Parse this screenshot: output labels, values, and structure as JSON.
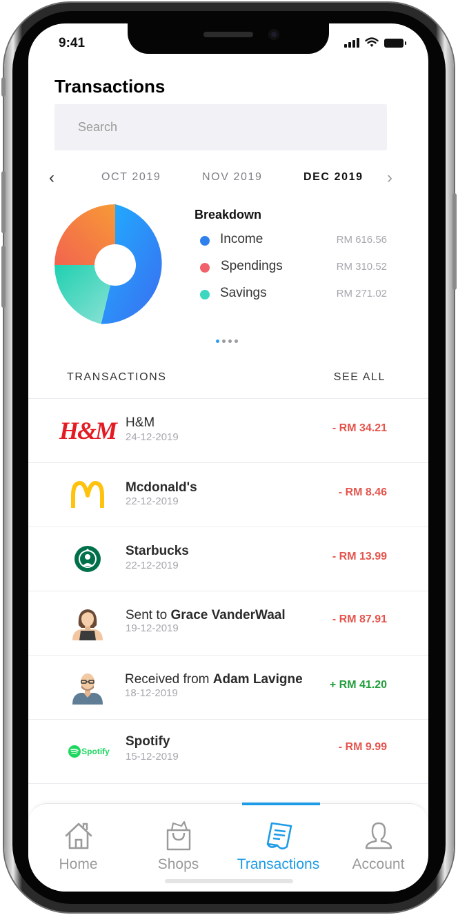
{
  "status": {
    "time": "9:41"
  },
  "header": {
    "title": "Transactions"
  },
  "search": {
    "placeholder": "Search"
  },
  "months": {
    "items": [
      "OCT 2019",
      "NOV 2019",
      "DEC 2019"
    ],
    "active": "DEC 2019",
    "prev_icon": "chevron-left-icon",
    "next_icon": "chevron-right-icon"
  },
  "breakdown": {
    "title": "Breakdown",
    "items": [
      {
        "label": "Income",
        "amount": "RM 616.56",
        "color": "#2f80ed"
      },
      {
        "label": "Spendings",
        "amount": "RM 310.52",
        "color": "#f0616b"
      },
      {
        "label": "Savings",
        "amount": "RM 271.02",
        "color": "#3dd6c0"
      }
    ]
  },
  "pager": {
    "count": 4,
    "active": 0
  },
  "transactions_section": {
    "heading": "TRANSACTIONS",
    "see_all": "SEE ALL"
  },
  "transactions": [
    {
      "prefix": "",
      "name": "H&M",
      "date": "24-12-2019",
      "amount": "- RM 34.21",
      "logo": "hm-logo",
      "logo_text": "H&M",
      "positive": false
    },
    {
      "prefix": "",
      "name": "Mcdonald's",
      "date": "22-12-2019",
      "amount": "- RM 8.46",
      "logo": "mcdonalds-logo",
      "logo_text": "",
      "positive": false
    },
    {
      "prefix": "",
      "name": "Starbucks",
      "date": "22-12-2019",
      "amount": "- RM 13.99",
      "logo": "starbucks-logo",
      "logo_text": "",
      "positive": false
    },
    {
      "prefix": "Sent to ",
      "name": "Grace VanderWaal",
      "date": "19-12-2019",
      "amount": "- RM 87.91",
      "logo": "avatar-female",
      "logo_text": "",
      "positive": false
    },
    {
      "prefix": "Received from ",
      "name": "Adam Lavigne",
      "date": "18-12-2019",
      "amount": "+ RM 41.20",
      "logo": "avatar-male",
      "logo_text": "",
      "positive": true
    },
    {
      "prefix": "",
      "name": "Spotify",
      "date": "15-12-2019",
      "amount": "- RM 9.99",
      "logo": "spotify-logo",
      "logo_text": "Spotify",
      "positive": false
    }
  ],
  "tabs": [
    {
      "label": "Home",
      "icon": "home-icon"
    },
    {
      "label": "Shops",
      "icon": "shopping-bag-icon"
    },
    {
      "label": "Transactions",
      "icon": "receipt-icon"
    },
    {
      "label": "Account",
      "icon": "user-icon"
    }
  ],
  "active_tab": "Transactions",
  "colors": {
    "accent": "#1d9be6",
    "negative": "#e5534b",
    "positive": "#1f9e3a"
  }
}
